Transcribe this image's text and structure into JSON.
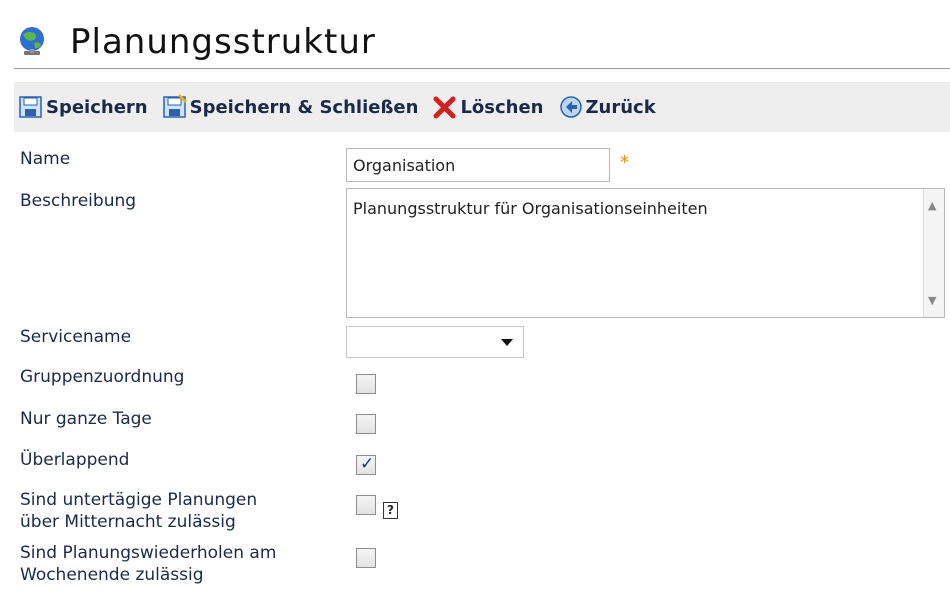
{
  "header": {
    "title": "Planungsstruktur",
    "icon": "globe-icon"
  },
  "toolbar": {
    "buttons": [
      {
        "label": "Speichern",
        "icon": "save-icon"
      },
      {
        "label": "Speichern & Schließen",
        "icon": "save-close-icon"
      },
      {
        "label": "Löschen",
        "icon": "delete-icon"
      },
      {
        "label": "Zurück",
        "icon": "back-icon"
      }
    ]
  },
  "form": {
    "name": {
      "label": "Name",
      "value": "Organisation",
      "required_mark": "*"
    },
    "beschreibung": {
      "label": "Beschreibung",
      "value": "Planungsstruktur für Organisationseinheiten"
    },
    "servicename": {
      "label": "Servicename",
      "value": ""
    },
    "gruppenzuordnung": {
      "label": "Gruppenzuordnung",
      "checked": false
    },
    "nur_ganze_tage": {
      "label": "Nur ganze Tage",
      "checked": false
    },
    "ueberlappend": {
      "label": "Überlappend",
      "checked": true,
      "check_glyph": "✓"
    },
    "untertaegig": {
      "label_line1": "Sind untertägige Planungen",
      "label_line2": "über Mitternacht zulässig",
      "checked": false,
      "help_glyph": "?"
    },
    "wochenende": {
      "label_line1": "Sind Planungswiederholen am",
      "label_line2": "Wochenende zulässig",
      "checked": false
    }
  },
  "colors": {
    "required": "#f28c00",
    "label": "#1b2a4a",
    "toolbar_bg": "#eeeeee"
  }
}
